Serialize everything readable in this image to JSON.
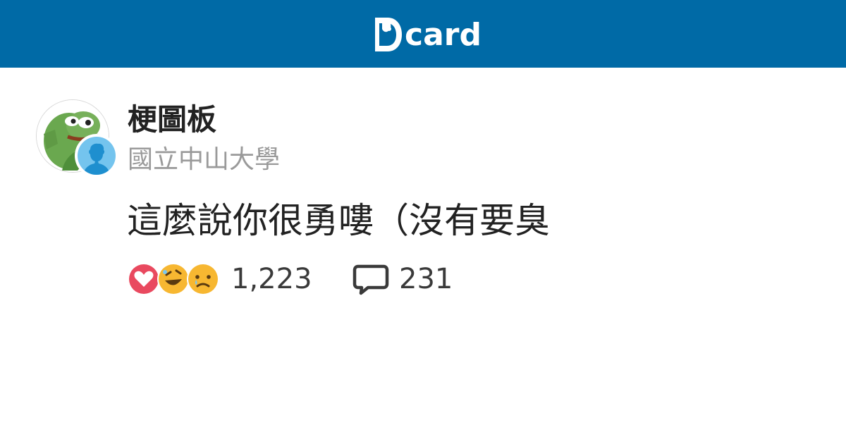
{
  "header": {
    "logo_text": "card",
    "logo_letter": "D",
    "background_color": "#006aa6"
  },
  "post": {
    "forum_name": "梗圖板",
    "school_name": "國立中山大學",
    "title": "這麼說你很勇嘍（沒有要臭",
    "avatar_icon": "pepe-frog-avatar",
    "school_badge_icon": "anonymous-user-icon"
  },
  "stats": {
    "reactions": [
      "heart-icon",
      "laughing-emoji-icon",
      "crying-emoji-icon"
    ],
    "reaction_count": "1,223",
    "comment_icon": "comment-bubble-icon",
    "comment_count": "231"
  },
  "colors": {
    "brand": "#006aa6",
    "text_primary": "#222222",
    "text_secondary": "#9a9a9a",
    "heart": "#e9495f",
    "emoji": "#f7b731"
  }
}
